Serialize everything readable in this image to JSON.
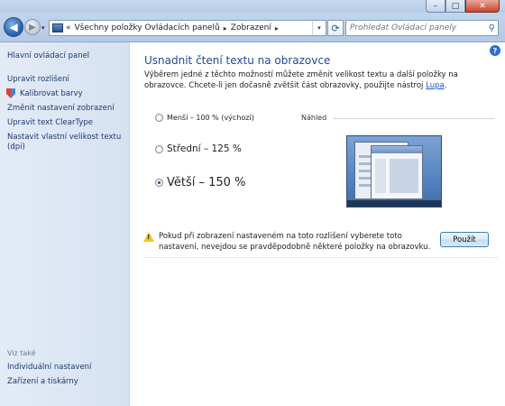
{
  "window": {
    "buttons": {
      "minimize": "–",
      "maximize": "□",
      "close": "✕"
    }
  },
  "nav": {
    "back_icon": "arrow-left-icon",
    "forward_icon": "arrow-right-icon",
    "breadcrumb_overflow": "«",
    "breadcrumb": [
      "Všechny položky Ovládacích panelů",
      "Zobrazení"
    ],
    "breadcrumb_separator": "▸",
    "refresh_icon": "refresh-icon",
    "search_placeholder": "Prohledat Ovládací panely"
  },
  "sidebar": {
    "home": "Hlavní ovládací panel",
    "items": [
      {
        "label": "Upravit rozlišení"
      },
      {
        "label": "Kalibrovat barvy",
        "icon": "shield-icon"
      },
      {
        "label": "Změnit nastavení zobrazení"
      },
      {
        "label": "Upravit text ClearType"
      },
      {
        "label": "Nastavit vlastní velikost textu (dpi)"
      }
    ],
    "related_heading": "Viz také",
    "related": [
      {
        "label": "Individuální nastavení"
      },
      {
        "label": "Zařízení a tiskárny"
      }
    ]
  },
  "main": {
    "title": "Usnadnit čtení textu na obrazovce",
    "description": "Výběrem jedné z těchto možností můžete změnit velikost textu a další položky na obrazovce. Chcete-li jen dočasně zvětšit část obrazovky, použijte nástroj",
    "description_link": "Lupa",
    "description_end": ".",
    "options": [
      {
        "label": "Menší – 100 % (výchozí)",
        "checked": false
      },
      {
        "label": "Střední – 125 %",
        "checked": false
      },
      {
        "label": "Větší – 150 %",
        "checked": true
      }
    ],
    "preview_label": "Náhled",
    "warning": "Pokud při zobrazení nastaveném na toto rozlišení vyberete toto nastavení, nevejdou se pravděpodobně některé položky na obrazovku.",
    "apply_button": "Použít",
    "help": "?"
  }
}
